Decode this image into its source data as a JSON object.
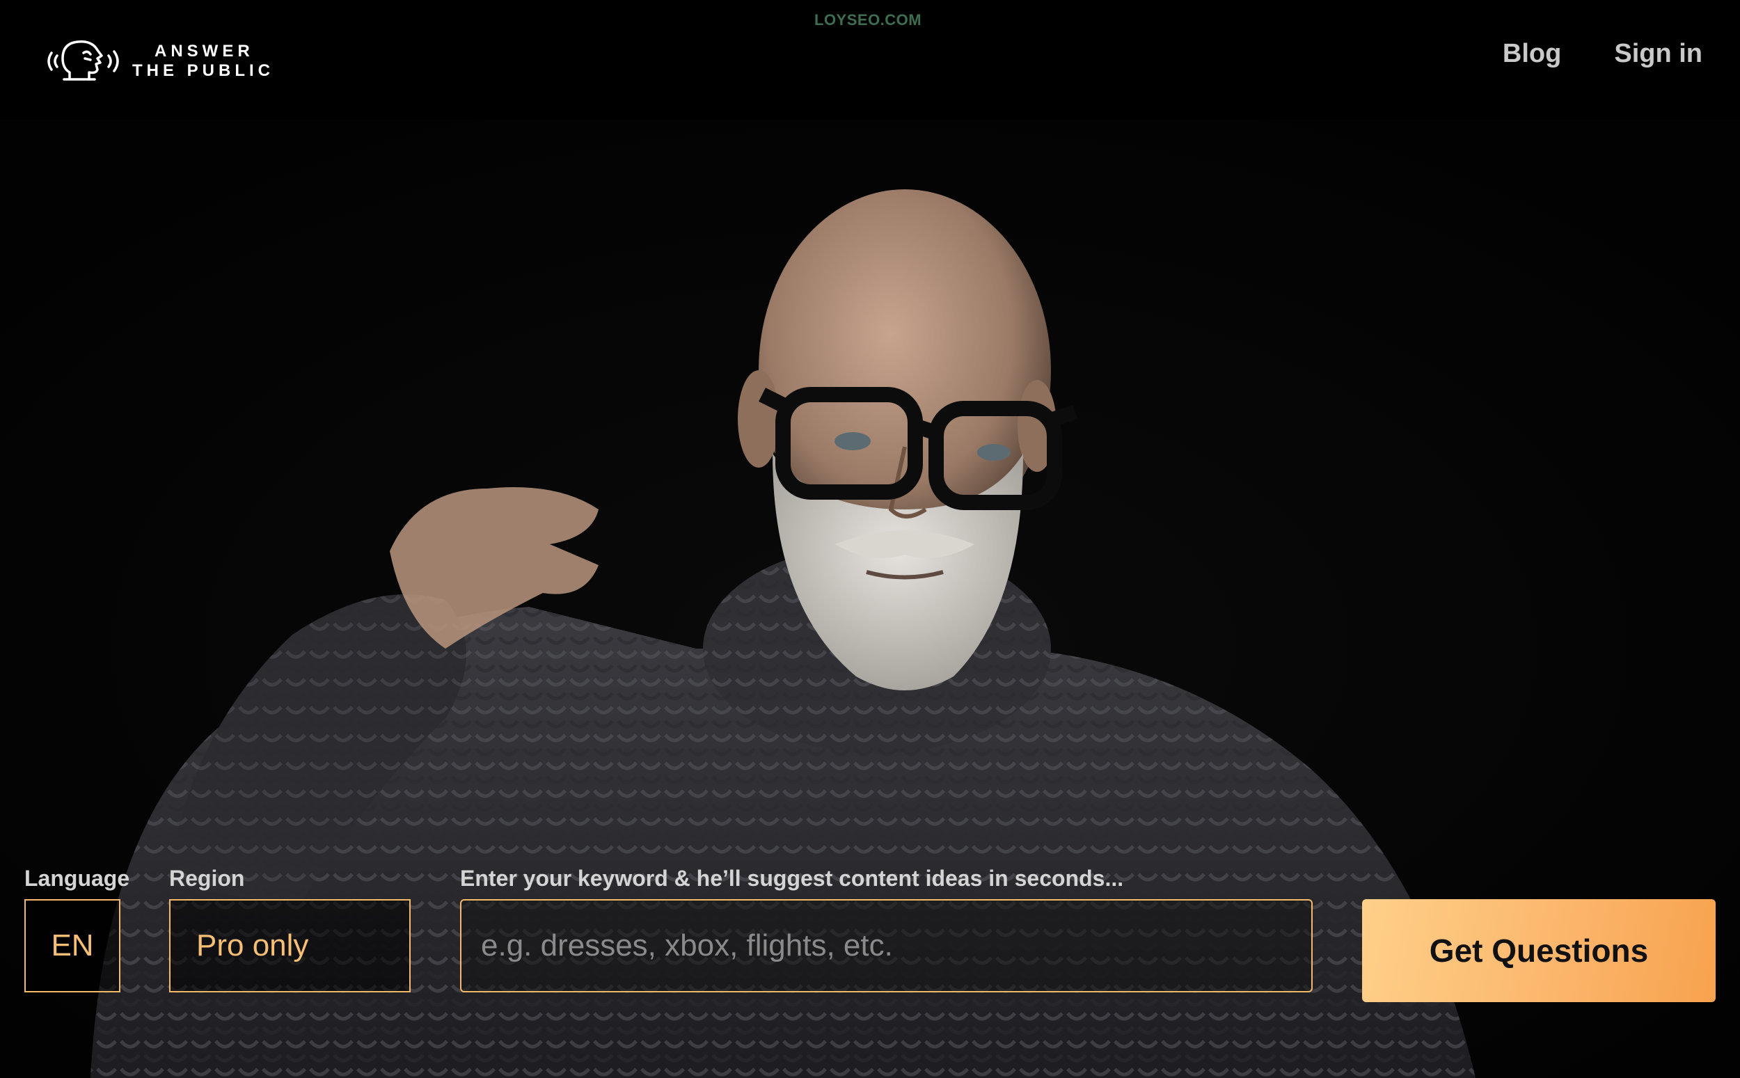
{
  "watermark": "LOYSEO.COM",
  "brand": {
    "line1": "ANSWER",
    "line2": "THE PUBLIC",
    "icon": "speaking-head-icon"
  },
  "nav": {
    "blog": "Blog",
    "sign_in": "Sign in"
  },
  "search": {
    "language_label": "Language",
    "language_value": "EN",
    "region_label": "Region",
    "region_value": "Pro only",
    "keyword_label": "Enter your keyword & he’ll suggest content ideas in seconds...",
    "keyword_placeholder": "e.g. dresses, xbox, flights, etc.",
    "submit_label": "Get Questions"
  },
  "colors": {
    "accent": "#f5b96a",
    "button_gradient_start": "#fed08a",
    "button_gradient_end": "#f7a24e",
    "background": "#000000"
  }
}
